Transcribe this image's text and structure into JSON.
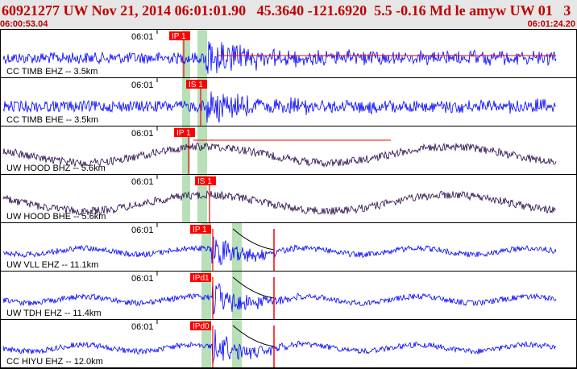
{
  "header": {
    "title": "60921277 UW Nov 21, 2014 06:01:01.90   45.3640 -121.6920  5.5 -0.16 Md le amyw UW 01   3",
    "start_time": "06:00:53.04",
    "end_time": "06:01:24.20"
  },
  "colors": {
    "header_text": "#c00000",
    "header_bg": "#e6e6e6",
    "trace_blue": "#0000ff",
    "trace_purple": "#2a0a4a",
    "pick_flag": "#ff0000",
    "window_band": "#b8e0b8"
  },
  "traces": [
    {
      "label": "CC TIMB EHZ -- 3.5km",
      "time_tick": "06:01",
      "pick": "IP 1",
      "color": "blue",
      "style": "ehz_near"
    },
    {
      "label": "CC TIMB EHE -- 3.5km",
      "time_tick": "06:01",
      "pick": "IS 1",
      "color": "blue",
      "style": "ehe_near"
    },
    {
      "label": "UW HOOD BHZ -- 5.6km",
      "time_tick": "06:01",
      "pick": "IP 1",
      "color": "purple",
      "style": "swell"
    },
    {
      "label": "UW HOOD BHE -- 5.6km",
      "time_tick": "06:01",
      "pick": "IS 1",
      "color": "purple",
      "style": "swell"
    },
    {
      "label": "UW VLL EHZ -- 11.1km",
      "time_tick": "06:01",
      "pick": "IP 1",
      "color": "blue",
      "style": "far"
    },
    {
      "label": "UW TDH EHZ -- 11.4km",
      "time_tick": "06:01",
      "pick": "IPd1",
      "color": "blue",
      "style": "far"
    },
    {
      "label": "CC HIYU EHZ -- 12.0km",
      "time_tick": "06:01",
      "pick": "IPd0",
      "color": "blue",
      "style": "far"
    }
  ]
}
